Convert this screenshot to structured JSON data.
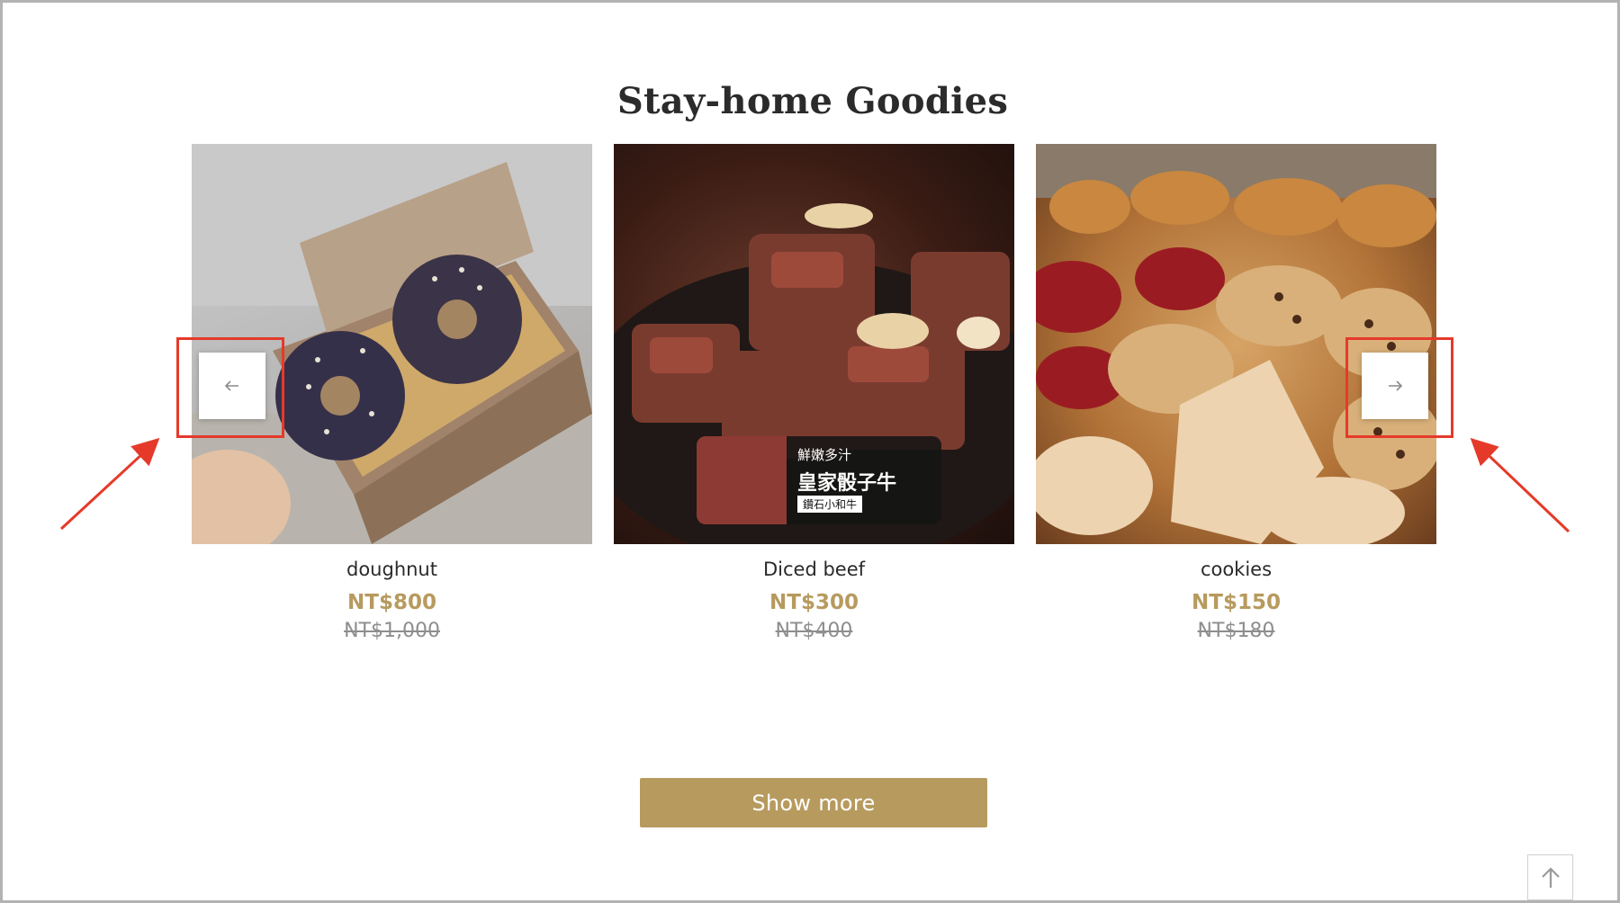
{
  "section": {
    "title": "Stay-home Goodies"
  },
  "products": [
    {
      "name": "doughnut",
      "price": "NT$800",
      "original_price": "NT$1,000",
      "image": "doughnut-box-photo"
    },
    {
      "name": "Diced beef",
      "price": "NT$300",
      "original_price": "NT$400",
      "image": "diced-beef-photo",
      "overlay": {
        "line1": "鮮嫩多汁",
        "line2": "皇家骰子牛",
        "line3": "鑽石小和牛"
      }
    },
    {
      "name": "cookies",
      "price": "NT$150",
      "original_price": "NT$180",
      "image": "cookies-pastries-photo"
    }
  ],
  "carousel": {
    "prev_icon": "arrow-left-icon",
    "next_icon": "arrow-right-icon"
  },
  "actions": {
    "show_more_label": "Show more"
  },
  "back_to_top_icon": "arrow-up-icon",
  "colors": {
    "accent": "#b79a5e",
    "highlight": "#e53a2a",
    "title": "#2b2b2b",
    "strike": "#8e8e8e"
  }
}
